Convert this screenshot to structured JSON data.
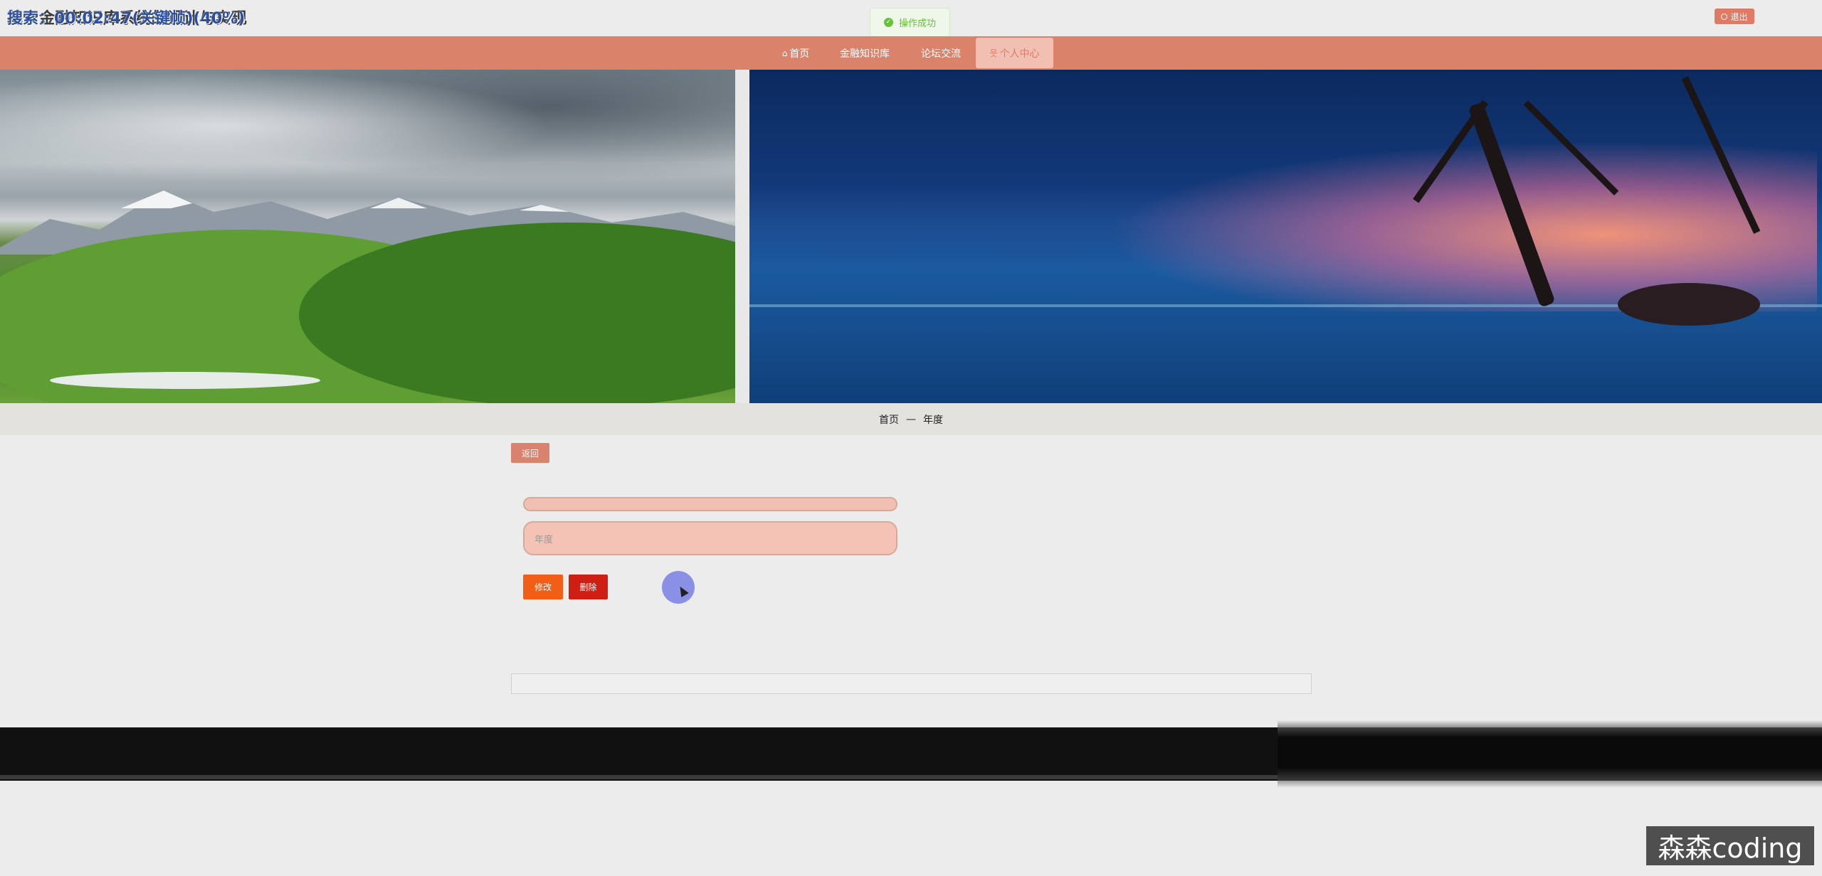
{
  "header": {
    "site_title_visible": "基于金融知识库系统的设计与实现",
    "search_overlay": "搜索：00:02:47(关键帧)(40%)",
    "toast_text": "操作成功",
    "logout_label": "退出"
  },
  "nav": {
    "items": [
      {
        "label": "首页",
        "icon": "home-icon"
      },
      {
        "label": "金融知识库",
        "icon": ""
      },
      {
        "label": "论坛交流",
        "icon": ""
      },
      {
        "label": "个人中心",
        "icon": "user-icon",
        "active": true
      }
    ]
  },
  "breadcrumb": {
    "home": "首页",
    "separator": "—",
    "current": "年度"
  },
  "form": {
    "back_label": "返回",
    "field2_placeholder": "年度",
    "edit_label": "修改",
    "delete_label": "删除"
  },
  "watermark": {
    "text": "森森coding"
  },
  "colors": {
    "nav_bg": "#da826a",
    "accent": "#e07a64",
    "edit": "#f25e16",
    "delete": "#cf1f14",
    "success": "#67c23a"
  }
}
